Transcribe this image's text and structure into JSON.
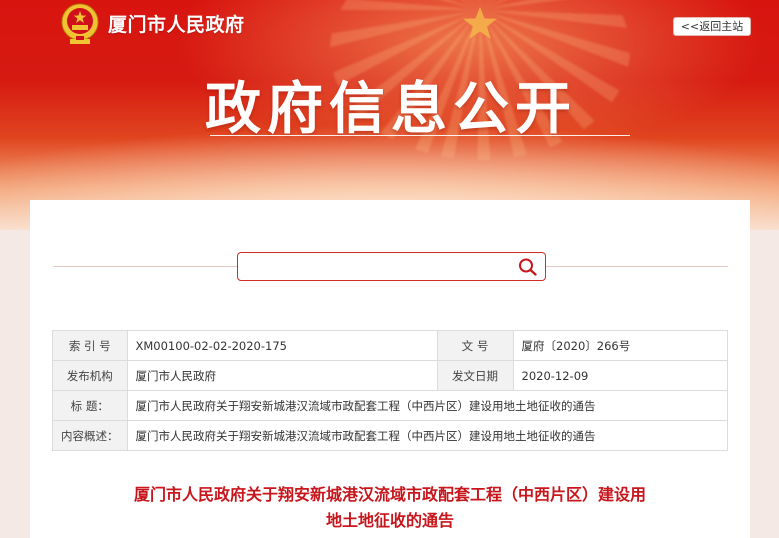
{
  "header": {
    "site_name": "厦门市人民政府",
    "back_label": "<<返回主站",
    "banner_title": "政府信息公开"
  },
  "search": {
    "placeholder": "",
    "value": ""
  },
  "metadata": {
    "index_label": "索 引 号",
    "index_value": "XM00100-02-02-2020-175",
    "doc_no_label": "文 号",
    "doc_no_value": "厦府〔2020〕266号",
    "issuer_label": "发布机构",
    "issuer_value": "厦门市人民政府",
    "date_label": "发文日期",
    "date_value": "2020-12-09",
    "title_label": "标    题：",
    "title_value": "厦门市人民政府关于翔安新城港汉流域市政配套工程（中西片区）建设用地土地征收的通告",
    "summary_label": "内容概述：",
    "summary_value": "厦门市人民政府关于翔安新城港汉流域市政配套工程（中西片区）建设用地土地征收的通告"
  },
  "document": {
    "title_line1": "厦门市人民政府关于翔安新城港汉流域市政配套工程（中西片区）建设用",
    "title_line2": "地土地征收的通告"
  },
  "colors": {
    "banner_red": "#d8140f",
    "accent_red": "#c8161d",
    "label_bg": "#f2f2f2"
  },
  "icons": {
    "emblem": "national-emblem-icon",
    "search": "search-icon",
    "star": "star-icon"
  }
}
